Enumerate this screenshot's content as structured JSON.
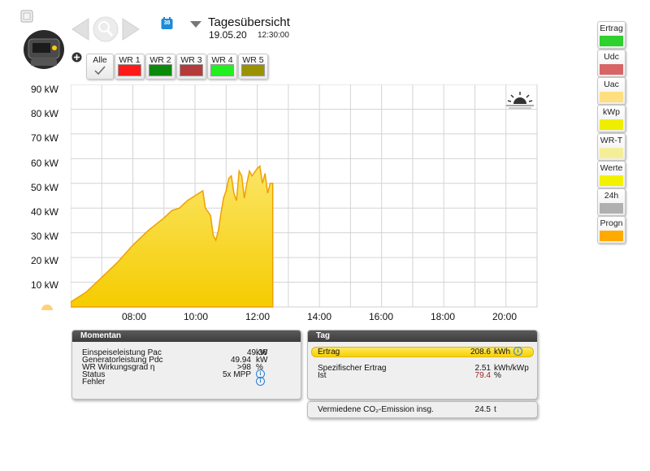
{
  "header": {
    "title": "Tagesübersicht",
    "date": "19.05.20",
    "time": "12:30:00",
    "calendar_label": "38"
  },
  "tabs": [
    {
      "label": "Alle",
      "color": null
    },
    {
      "label": "WR 1",
      "color": "#ff1a1a"
    },
    {
      "label": "WR 2",
      "color": "#0a8a0a"
    },
    {
      "label": "WR 3",
      "color": "#b53a3a"
    },
    {
      "label": "WR 4",
      "color": "#22ee22"
    },
    {
      "label": "WR 5",
      "color": "#9a9200"
    }
  ],
  "right_buttons": [
    {
      "label": "Ertrag",
      "color": "#2ed12e"
    },
    {
      "label": "Udc",
      "color": "#d86565"
    },
    {
      "label": "Uac",
      "color": "#ffdf80"
    },
    {
      "label": "kWp",
      "color": "#eeee00"
    },
    {
      "label": "WR-T",
      "color": "#f5ee99"
    },
    {
      "label": "Werte",
      "color": "#f2f200"
    },
    {
      "label": "24h",
      "color": "#b0b0b0"
    },
    {
      "label": "Progn",
      "color": "#ffaa00"
    }
  ],
  "chart_data": {
    "type": "area",
    "y_ticks": [
      "10 kW",
      "20 kW",
      "30 kW",
      "40 kW",
      "50 kW",
      "60 kW",
      "70 kW",
      "80 kW",
      "90 kW"
    ],
    "x_ticks": [
      "08:00",
      "10:00",
      "12:00",
      "14:00",
      "16:00",
      "18:00",
      "20:00"
    ],
    "ylim": [
      0,
      90
    ],
    "xlim": [
      "06:00",
      "21:00"
    ],
    "grid": true,
    "fill_color": "#f5cc00",
    "line_color": "#f0a000",
    "x": [
      "06:00",
      "06:30",
      "07:00",
      "07:30",
      "08:00",
      "08:30",
      "09:00",
      "09:15",
      "09:30",
      "09:45",
      "10:00",
      "10:15",
      "10:20",
      "10:30",
      "10:35",
      "10:40",
      "10:45",
      "10:50",
      "10:55",
      "11:00",
      "11:05",
      "11:10",
      "11:15",
      "11:20",
      "11:25",
      "11:30",
      "11:35",
      "11:40",
      "11:45",
      "11:50",
      "12:00",
      "12:05",
      "12:10",
      "12:15",
      "12:20",
      "12:25",
      "12:30"
    ],
    "y": [
      2,
      6,
      12,
      18,
      25,
      31,
      36,
      39,
      40,
      43,
      45,
      47,
      40,
      37,
      29,
      27,
      31,
      38,
      44,
      47,
      52,
      53,
      46,
      43,
      55,
      53,
      44,
      50,
      55,
      53,
      56,
      57,
      50,
      54,
      46,
      50,
      50
    ]
  },
  "momentan": {
    "title": "Momentan",
    "rows": [
      {
        "label": "Einspeiseleistung Pac",
        "value": "49.36",
        "unit": "kW"
      },
      {
        "label": "Generatorleistung Pdc",
        "value": "49.94",
        "unit": "kW"
      },
      {
        "label": "WR Wirkungsgrad η",
        "value": ">98",
        "unit": "%"
      },
      {
        "label": "Status",
        "value": "5x MPP",
        "unit": "i"
      },
      {
        "label": "Fehler",
        "value": "",
        "unit": "i"
      }
    ]
  },
  "tag": {
    "title": "Tag",
    "ertrag_label": "Ertrag",
    "ertrag_value": "208.6",
    "ertrag_unit": "kWh",
    "spez_label": "Spezifischer Ertrag",
    "spez_value": "2.51",
    "spez_unit": "kWh/kWp",
    "ist_label": "Ist",
    "ist_value": "79.4",
    "ist_unit": "%",
    "ist_color": "#9a1f1f"
  },
  "co2": {
    "label": "Vermiedene CO₂-Emission insg.",
    "value": "24.5",
    "unit": "t"
  }
}
